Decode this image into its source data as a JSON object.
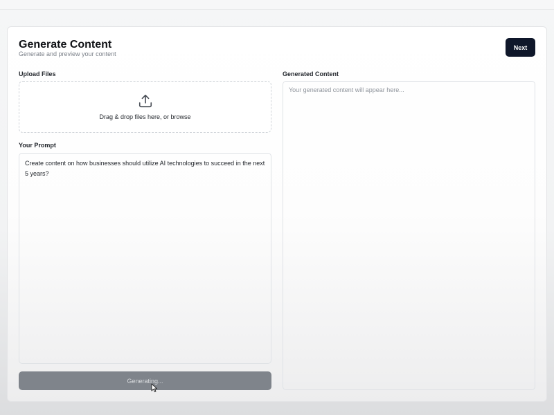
{
  "header": {
    "title": "Generate Content",
    "subtitle": "Generate and preview your content",
    "next_label": "Next"
  },
  "upload": {
    "label": "Upload Files",
    "dropzone_text": "Drag & drop files here, or browse",
    "icon": "upload-icon"
  },
  "prompt": {
    "label": "Your Prompt",
    "value": "Create content on how businesses should utilize AI technologies to succeed in the next 5 years?"
  },
  "generate": {
    "label": "Generating...",
    "state": "disabled"
  },
  "output": {
    "label": "Generated Content",
    "placeholder": "Your generated content will appear here..."
  },
  "colors": {
    "primary_button": "#0f172a",
    "disabled_button": "#7f848b"
  }
}
